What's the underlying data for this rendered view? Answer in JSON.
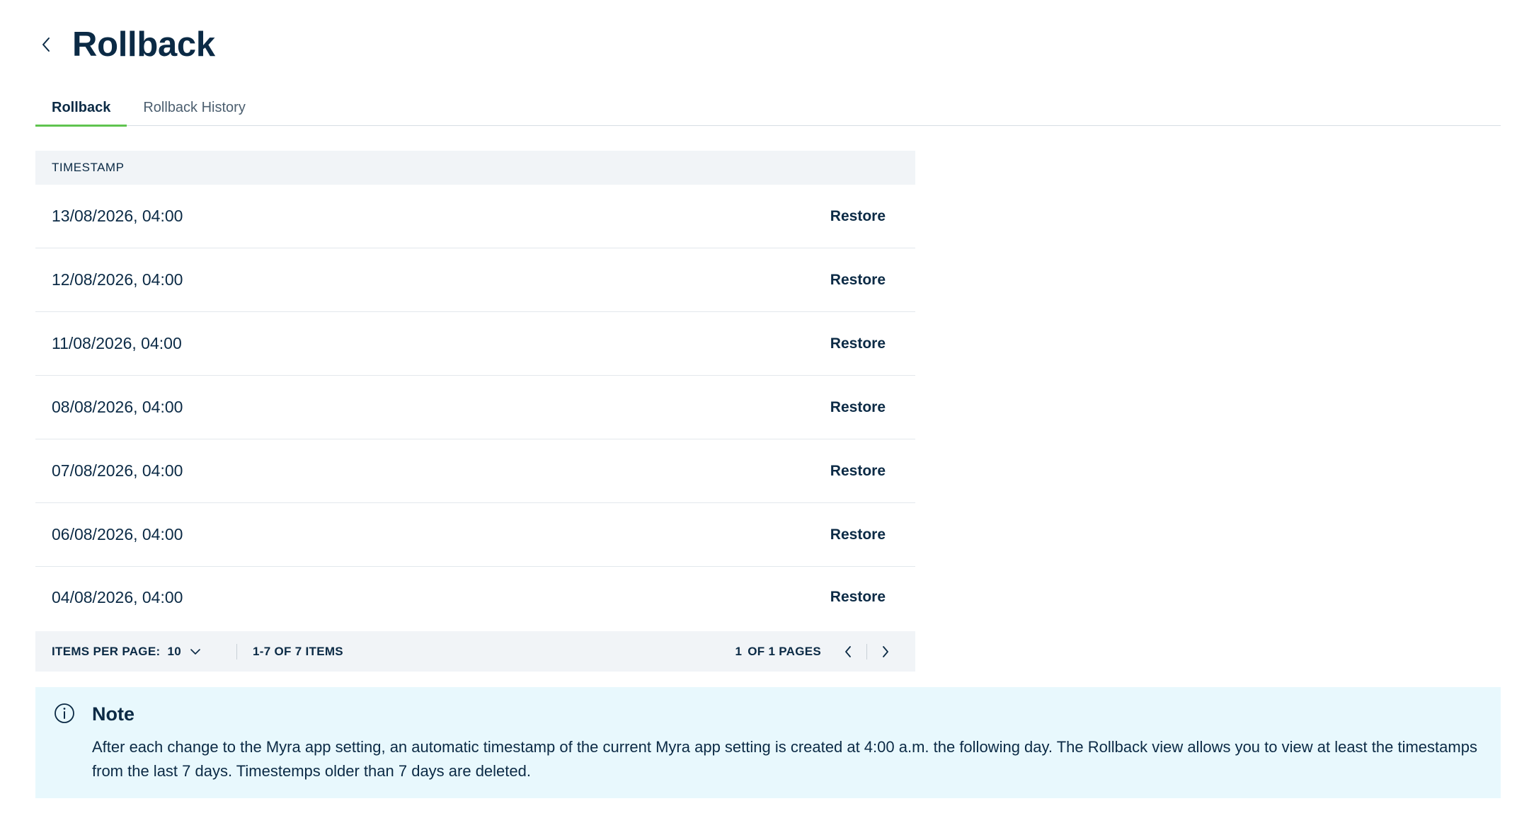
{
  "page": {
    "title": "Rollback"
  },
  "tabs": [
    {
      "label": "Rollback",
      "active": true
    },
    {
      "label": "Rollback History",
      "active": false
    }
  ],
  "table": {
    "column_header": "TIMESTAMP",
    "action_label": "Restore",
    "rows": [
      {
        "timestamp": "13/08/2026, 04:00",
        "action": "Restore"
      },
      {
        "timestamp": "12/08/2026, 04:00",
        "action": "Restore"
      },
      {
        "timestamp": "11/08/2026, 04:00",
        "action": "Restore"
      },
      {
        "timestamp": "08/08/2026, 04:00",
        "action": "Restore"
      },
      {
        "timestamp": "07/08/2026, 04:00",
        "action": "Restore"
      },
      {
        "timestamp": "06/08/2026, 04:00",
        "action": "Restore"
      },
      {
        "timestamp": "04/08/2026, 04:00",
        "action": "Restore"
      }
    ]
  },
  "pagination": {
    "items_per_page_label": "ITEMS PER PAGE:",
    "items_per_page_value": "10",
    "range_text": "1-7 OF 7 ITEMS",
    "current_page": "1",
    "pages_text": "OF 1 PAGES"
  },
  "note": {
    "title": "Note",
    "text": "After each change to the Myra app setting, an automatic timestamp of the current Myra app setting is created at 4:00 a.m. the following day. The Rollback view allows you to view at least the timestamps from the last 7 days. Timestemps older than 7 days are deleted."
  },
  "colors": {
    "text": "#0b2a45",
    "tab_active_underline": "#5fc44f",
    "table_header_bg": "#f1f4f7",
    "note_bg": "#e8f8fd"
  },
  "icons": {
    "back": "chevron-left-icon",
    "dropdown": "chevron-down-icon",
    "prev": "chevron-left-icon",
    "next": "chevron-right-icon",
    "note": "info-icon"
  }
}
